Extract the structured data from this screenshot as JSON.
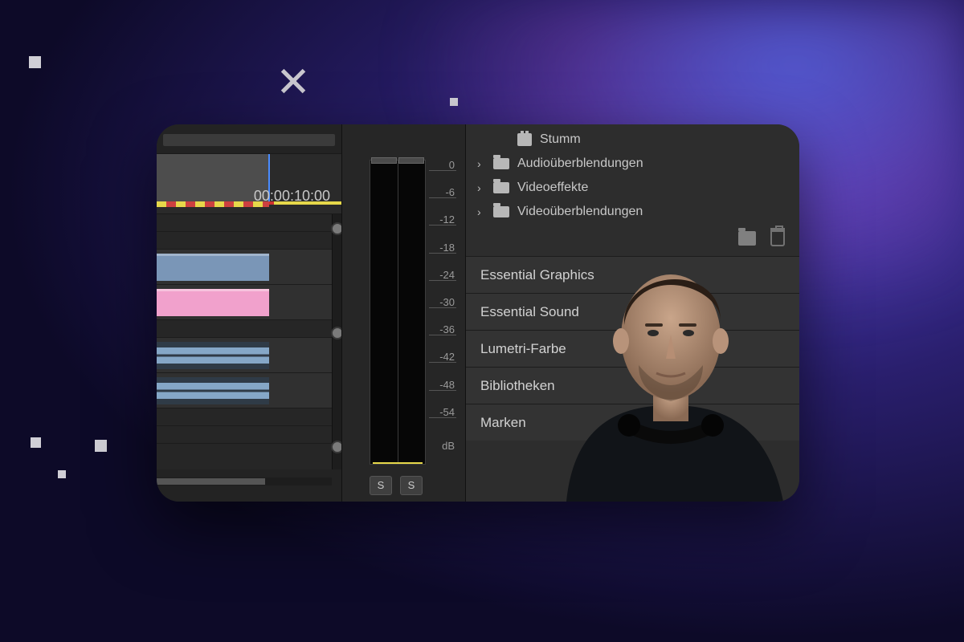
{
  "timeline": {
    "timecode": "00:00:10:00",
    "solo_label": "S"
  },
  "audio_meter": {
    "scale": [
      "0",
      "-6",
      "-12",
      "-18",
      "-24",
      "-30",
      "-36",
      "-42",
      "-48",
      "-54",
      "dB"
    ]
  },
  "effects": {
    "preset_item": "Stumm",
    "folders": [
      "Audioüberblendungen",
      "Videoeffekte",
      "Videoüberblendungen"
    ]
  },
  "panels": [
    "Essential Graphics",
    "Essential Sound",
    "Lumetri-Farbe",
    "Bibliotheken",
    "Marken"
  ]
}
